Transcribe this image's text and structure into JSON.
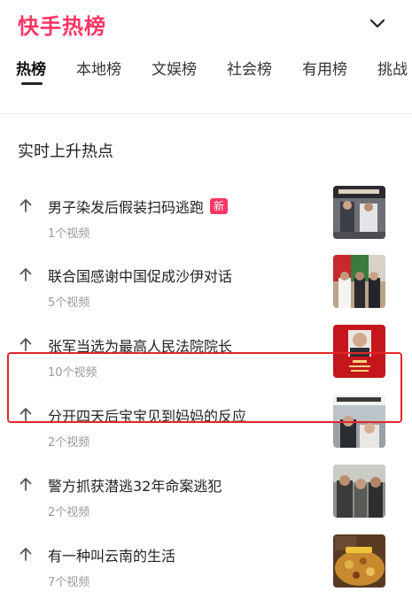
{
  "colors": {
    "brand": "#fe3666",
    "highlight_border": "#e0262a",
    "new_badge": "#fe3666"
  },
  "header": {
    "title": "快手热榜",
    "collapse_icon": "chevron-down-icon"
  },
  "tabs": [
    {
      "label": "热榜",
      "active": true
    },
    {
      "label": "本地榜",
      "active": false
    },
    {
      "label": "文娱榜",
      "active": false
    },
    {
      "label": "社会榜",
      "active": false
    },
    {
      "label": "有用榜",
      "active": false
    },
    {
      "label": "挑战",
      "active": false
    }
  ],
  "section_title": "实时上升热点",
  "items": [
    {
      "title": "男子染发后假装扫码逃跑",
      "badge": "新",
      "count": "1个视频",
      "trend_icon": "arrow-up-icon"
    },
    {
      "title": "联合国感谢中国促成沙伊对话",
      "count": "5个视频",
      "trend_icon": "arrow-up-icon"
    },
    {
      "title": "张军当选为最高人民法院院长",
      "count": "10个视频",
      "trend_icon": "arrow-up-icon"
    },
    {
      "title": "分开四天后宝宝见到妈妈的反应",
      "count": "2个视频",
      "trend_icon": "arrow-up-icon"
    },
    {
      "title": "警方抓获潜逃32年命案逃犯",
      "count": "2个视频",
      "trend_icon": "arrow-up-icon"
    },
    {
      "title": "有一种叫云南的生活",
      "count": "7个视频",
      "trend_icon": "arrow-up-icon",
      "highlighted": true
    }
  ]
}
